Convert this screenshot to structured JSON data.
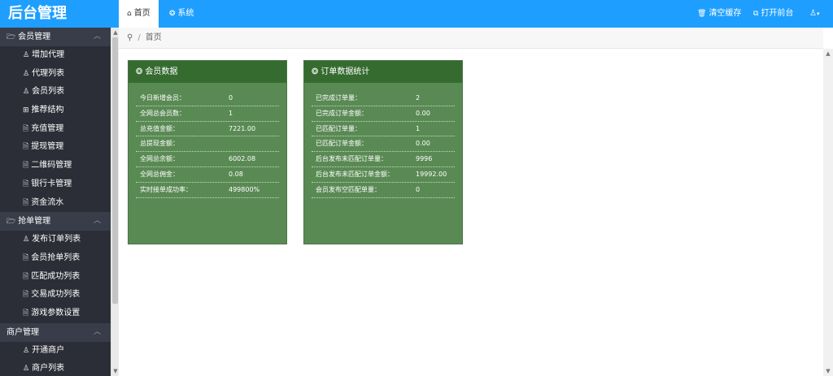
{
  "header": {
    "logo": "后台管理",
    "tabs": [
      {
        "label": "首页",
        "icon": "home-icon"
      },
      {
        "label": "系统",
        "icon": "gear-icon"
      }
    ],
    "right": [
      {
        "label": "清空缓存",
        "icon": "trash-icon"
      },
      {
        "label": "打开前台",
        "icon": "external-link-icon"
      }
    ],
    "user_icon": "user-icon"
  },
  "sidebar": {
    "groups": [
      {
        "label": "会员管理",
        "icon": "folder-icon",
        "items": [
          {
            "label": "增加代理",
            "icon": "user-icon"
          },
          {
            "label": "代理列表",
            "icon": "user-icon"
          },
          {
            "label": "会员列表",
            "icon": "user-icon"
          },
          {
            "label": "推荐结构",
            "icon": "grid-icon"
          },
          {
            "label": "充值管理",
            "icon": "document-icon"
          },
          {
            "label": "提现管理",
            "icon": "document-icon"
          },
          {
            "label": "二维码管理",
            "icon": "document-icon"
          },
          {
            "label": "银行卡管理",
            "icon": "document-icon"
          },
          {
            "label": "资金流水",
            "icon": "document-icon"
          }
        ]
      },
      {
        "label": "抢单管理",
        "icon": "folder-icon",
        "items": [
          {
            "label": "发布订单列表",
            "icon": "user-icon"
          },
          {
            "label": "会员抢单列表",
            "icon": "document-icon"
          },
          {
            "label": "匹配成功列表",
            "icon": "document-icon"
          },
          {
            "label": "交易成功列表",
            "icon": "document-icon"
          },
          {
            "label": "游戏参数设置",
            "icon": "document-icon"
          }
        ]
      },
      {
        "label": "商户管理",
        "icon": "",
        "items": [
          {
            "label": "开通商户",
            "icon": "user-icon"
          },
          {
            "label": "商户列表",
            "icon": "user-icon"
          }
        ]
      }
    ]
  },
  "breadcrumb": {
    "icon": "location-icon",
    "separator": "/",
    "current": "首页"
  },
  "panels": [
    {
      "title": "会员数据",
      "icon": "gear-icon",
      "rows": [
        {
          "label": "今日新增会员：",
          "value": "0"
        },
        {
          "label": "全网总会员数：",
          "value": "1"
        },
        {
          "label": "总充值金额：",
          "value": "7221.00"
        },
        {
          "label": "总提现金额：",
          "value": ""
        },
        {
          "label": "全网总余额：",
          "value": "6002.08"
        },
        {
          "label": "全网总佣金：",
          "value": "0.08"
        },
        {
          "label": "实时接单成功率：",
          "value": "499800%"
        }
      ]
    },
    {
      "title": "订单数据统计",
      "icon": "gear-icon",
      "rows": [
        {
          "label": "已完成订单量：",
          "value": "2"
        },
        {
          "label": "已完成订单金额：",
          "value": "0.00"
        },
        {
          "label": "已匹配订单量：",
          "value": "1"
        },
        {
          "label": "已匹配订单金额：",
          "value": "0.00"
        },
        {
          "label": "后台发布未匹配订单量：",
          "value": "9996"
        },
        {
          "label": "后台发布未匹配订单金额：",
          "value": "19992.00"
        },
        {
          "label": "会员发布空匹配单量：",
          "value": "0"
        }
      ]
    }
  ],
  "colors": {
    "header_bg": "#1e9fff",
    "sidebar_bg": "#393d49",
    "sidebar_items_bg": "#2b2e37",
    "panel_head": "#356b2f",
    "panel_body": "#5a8a54"
  }
}
